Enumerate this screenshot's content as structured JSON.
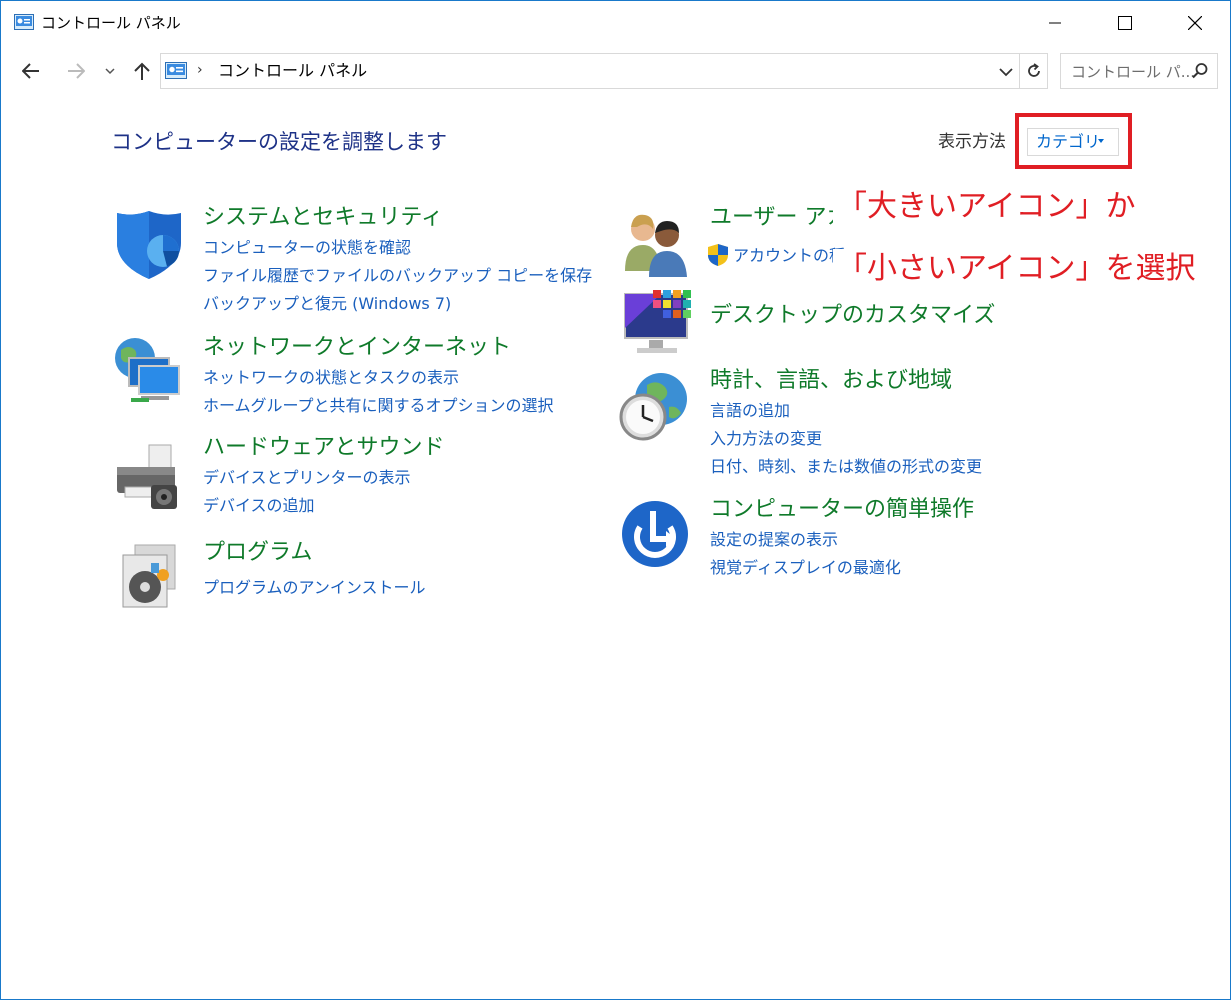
{
  "window": {
    "title": "コントロール パネル"
  },
  "address": {
    "path": "コントロール パネル",
    "separator": "›"
  },
  "search": {
    "placeholder": "コントロール パ..."
  },
  "content": {
    "heading": "コンピューターの設定を調整します",
    "view_label": "表示方法",
    "view_value": "カテゴリ"
  },
  "categories": [
    {
      "title": "システムとセキュリティ",
      "links": [
        "コンピューターの状態を確認",
        "ファイル履歴でファイルのバックアップ コピーを保存",
        "バックアップと復元 (Windows 7)"
      ]
    },
    {
      "title": "ネットワークとインターネット",
      "links": [
        "ネットワークの状態とタスクの表示",
        "ホームグループと共有に関するオプションの選択"
      ]
    },
    {
      "title": "ハードウェアとサウンド",
      "links": [
        "デバイスとプリンターの表示",
        "デバイスの追加"
      ]
    },
    {
      "title": "プログラム",
      "links": [
        "プログラムのアンインストール"
      ]
    },
    {
      "title": "ユーザー アカ",
      "links": [
        "アカウントの種"
      ]
    },
    {
      "title": "デスクトップのカスタマイズ",
      "links": []
    },
    {
      "title": "時計、言語、および地域",
      "links": [
        "言語の追加",
        "入力方法の変更",
        "日付、時刻、または数値の形式の変更"
      ]
    },
    {
      "title": "コンピューターの簡単操作",
      "links": [
        "設定の提案の表示",
        "視覚ディスプレイの最適化"
      ]
    }
  ],
  "annotation": {
    "line1": "「大きいアイコン」か",
    "line2": "「小さいアイコン」を選択",
    "color": "#e01e24"
  },
  "colors": {
    "category_title": "#0f7a2a",
    "link": "#1a5fbd",
    "heading": "#1e3287",
    "border": "#1979ca"
  }
}
